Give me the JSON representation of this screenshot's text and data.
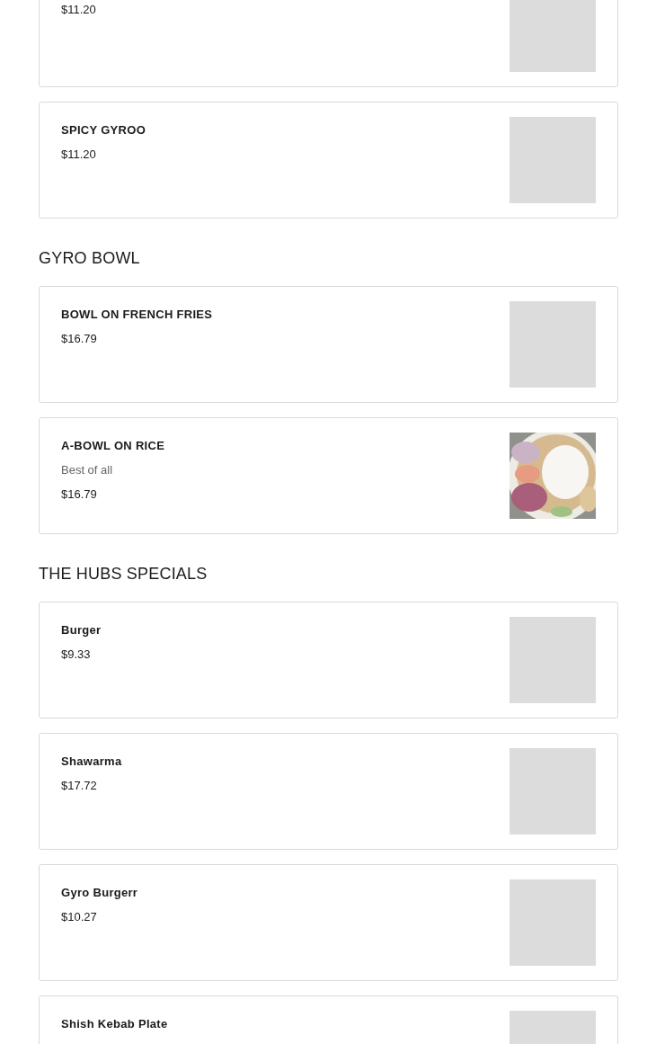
{
  "sections": [
    {
      "items": [
        {
          "price": "$11.20",
          "image": {
            "kind": "placeholder"
          }
        },
        {
          "name": "SPICY GYROO",
          "price": "$11.20",
          "image": {
            "kind": "placeholder"
          }
        }
      ]
    },
    {
      "title": "GYRO BOWL",
      "items": [
        {
          "name": "BOWL ON FRENCH FRIES",
          "price": "$16.79",
          "image": {
            "kind": "placeholder"
          }
        },
        {
          "name": "A-BOWL ON RICE",
          "description": "Best of all",
          "price": "$16.79"
        }
      ]
    },
    {
      "title": "THE HUBS SPECIALS",
      "items": [
        {
          "name": "Burger",
          "price": "$9.33",
          "image": {
            "kind": "placeholder"
          }
        },
        {
          "name": "Shawarma",
          "price": "$17.72",
          "image": {
            "kind": "placeholder"
          }
        },
        {
          "name": "Gyro Burgerr",
          "price": "$10.27",
          "image": {
            "kind": "placeholder"
          }
        },
        {
          "name": "Shish Kebab Plate",
          "image": {
            "kind": "placeholder"
          }
        }
      ]
    }
  ]
}
